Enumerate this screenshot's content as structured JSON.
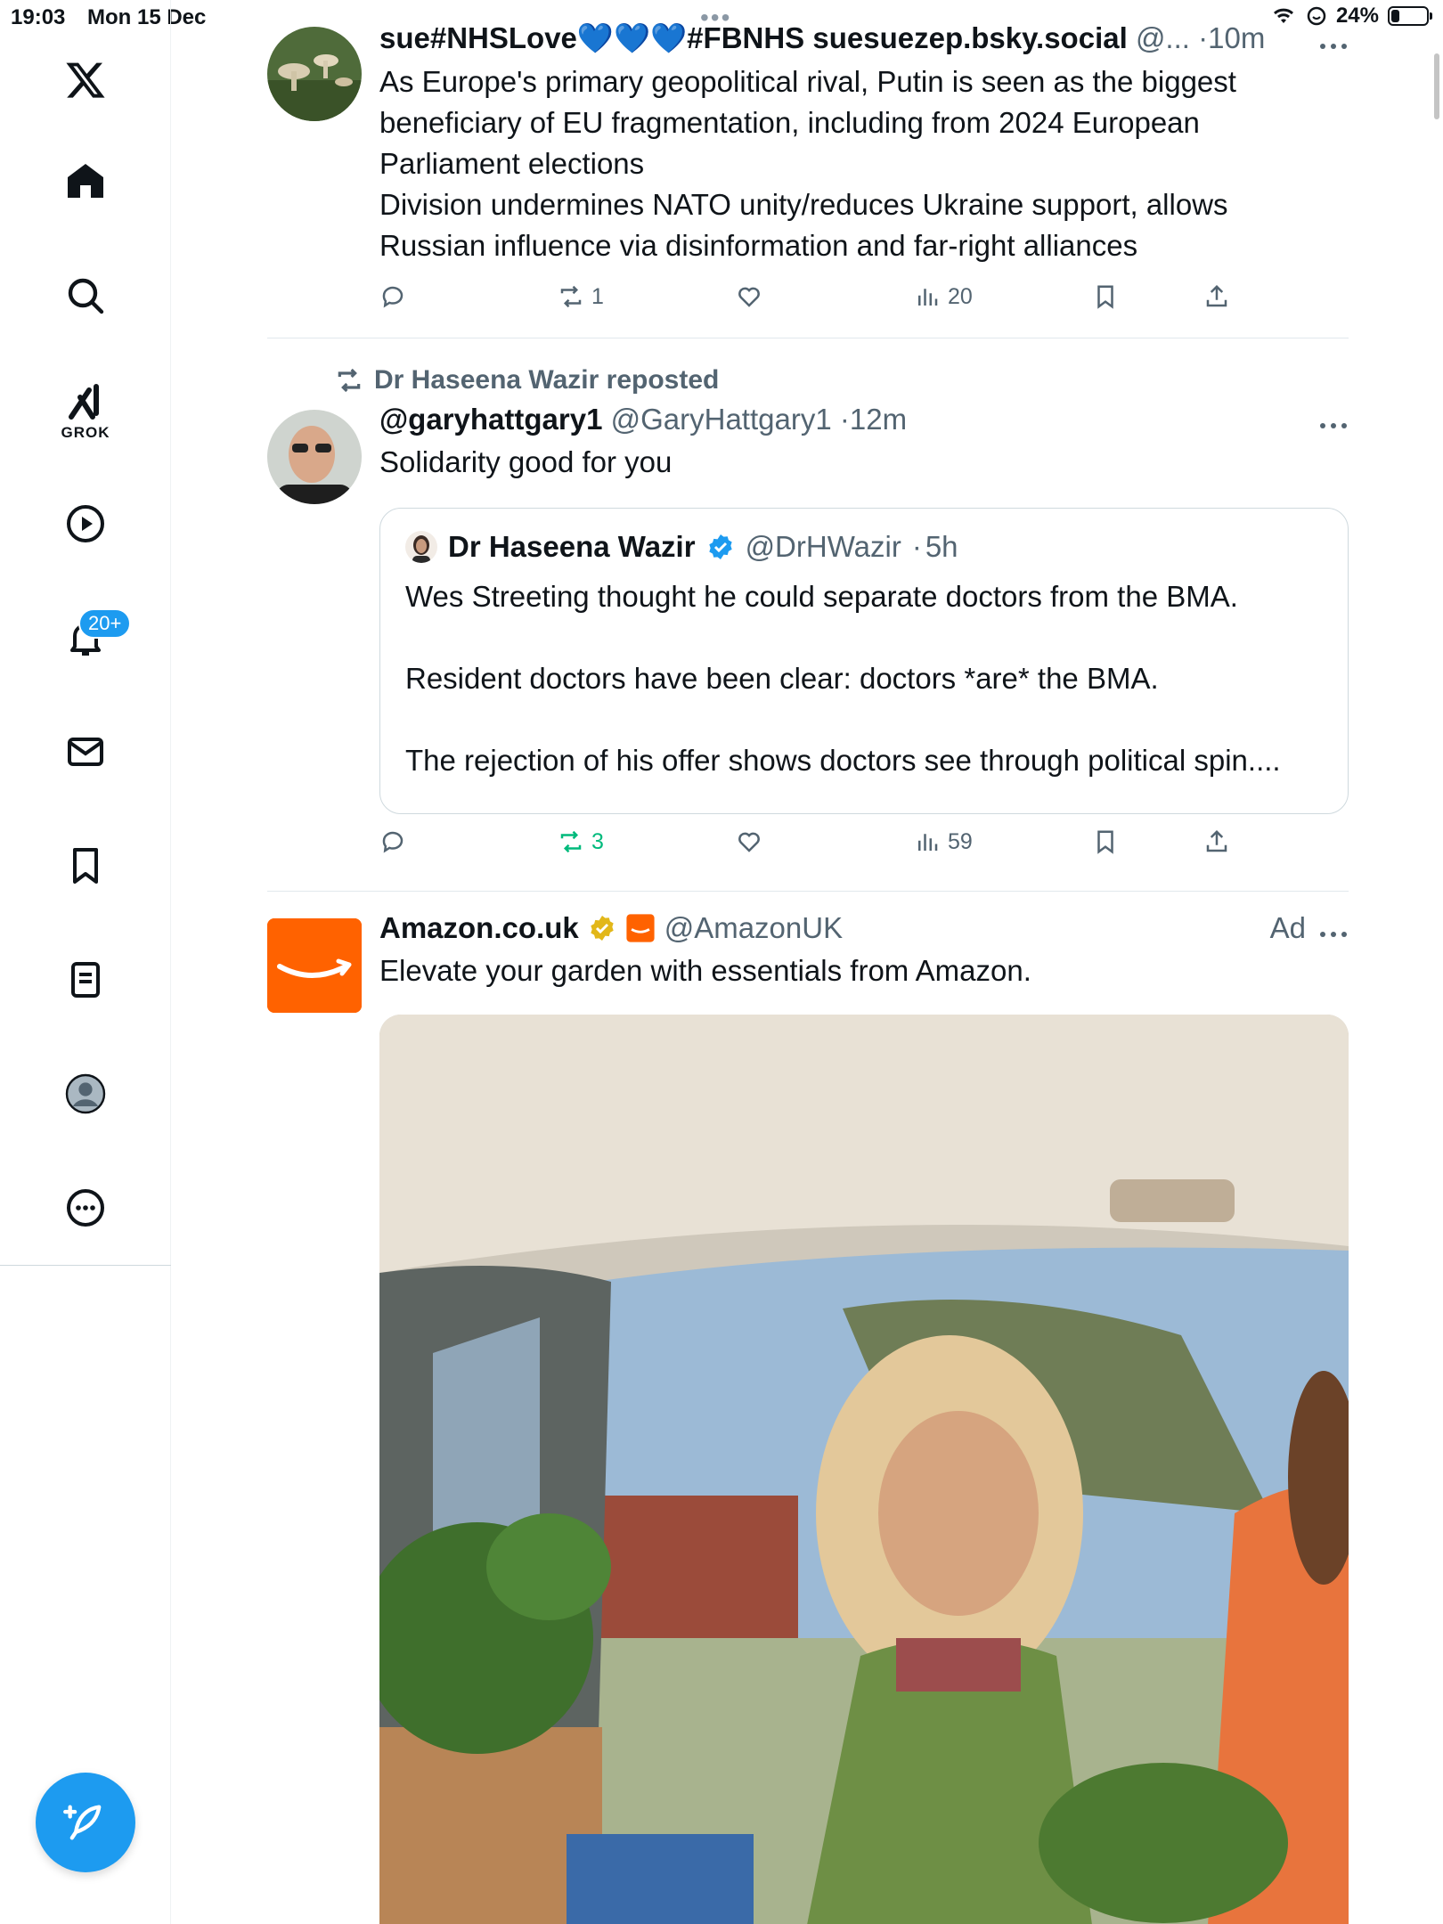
{
  "status_bar": {
    "time": "19:03",
    "date": "Mon 15 Dec",
    "battery": "24%",
    "battery_level": 0.24
  },
  "sidebar": {
    "items": [
      {
        "name": "x-logo",
        "label": "X"
      },
      {
        "name": "home",
        "label": "Home"
      },
      {
        "name": "search",
        "label": "Search"
      },
      {
        "name": "grok",
        "label": "GROK"
      },
      {
        "name": "video",
        "label": "Video"
      },
      {
        "name": "notifications",
        "label": "Notifications",
        "badge": "20+"
      },
      {
        "name": "messages",
        "label": "Messages"
      },
      {
        "name": "bookmarks",
        "label": "Bookmarks"
      },
      {
        "name": "lists",
        "label": "Lists"
      },
      {
        "name": "profile",
        "label": "Profile"
      },
      {
        "name": "more",
        "label": "More"
      }
    ],
    "compose_icon": "feather-plus-icon"
  },
  "colors": {
    "accent": "#1d9bf0",
    "repost_green": "#00ba7c",
    "amazon_orange": "#ff6200",
    "secondary_text": "#536471"
  },
  "feed": {
    "tweets": [
      {
        "display_name": "sue#NHSLove💙💙💙#FBNHS suesuezep.bsky.social",
        "handle": "@...",
        "time": "10m",
        "lines": [
          "As Europe's primary geopolitical rival, Putin is seen as the biggest",
          "beneficiary of EU fragmentation, including from 2024 European",
          "Parliament elections",
          "Division undermines NATO unity/reduces Ukraine support,  allows",
          "Russian influence via disinformation and far-right alliances"
        ],
        "replies": "",
        "reposts": "1",
        "likes": "",
        "views": "20"
      },
      {
        "repost_by": "Dr Haseena Wazir reposted",
        "display_name": "@garyhattgary1",
        "handle": "@GaryHattgary1",
        "time": "12m",
        "text": "Solidarity good for you",
        "quote": {
          "display_name": "Dr Haseena Wazir",
          "handle": "@DrHWazir",
          "time": "5h",
          "paragraphs": [
            "Wes Streeting thought he could separate doctors from the BMA.",
            "",
            "Resident doctors have been clear: doctors *are* the BMA.",
            "",
            "The rejection of his offer shows doctors see through political spin...."
          ]
        },
        "replies": "",
        "reposts": "3",
        "likes": "",
        "views": "59"
      },
      {
        "display_name": "Amazon.co.uk",
        "handle": "@AmazonUK",
        "ad_label": "Ad",
        "text": "Elevate your garden with essentials from Amazon."
      }
    ]
  }
}
